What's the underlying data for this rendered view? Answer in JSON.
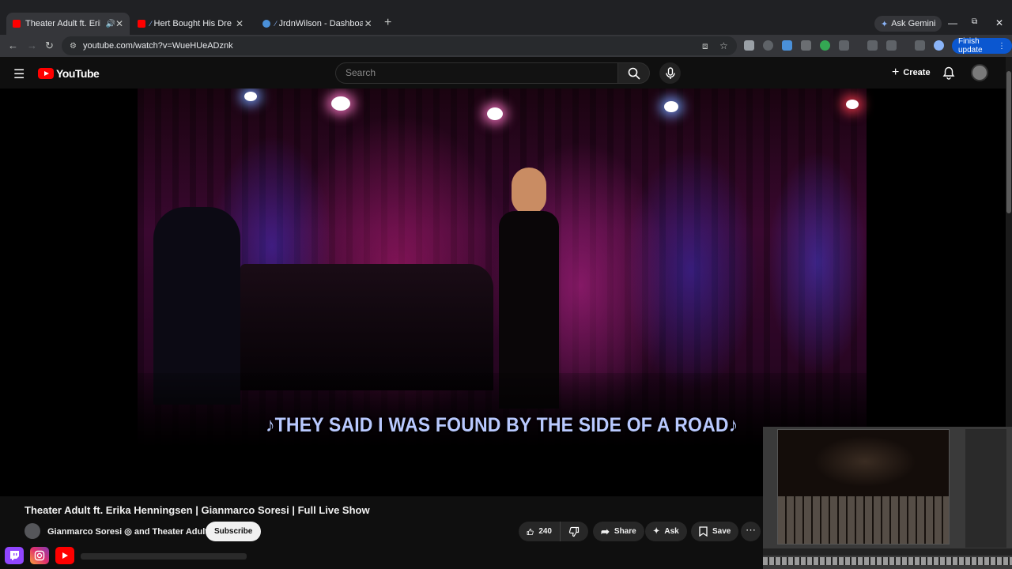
{
  "browser": {
    "tabs": [
      {
        "title": "Theater Adult ft. Erika Henn",
        "active": true,
        "favicon_color": "#ff0000"
      },
      {
        "title": "Hert Bought His Dream Car",
        "active": false,
        "favicon_color": "#ff0000"
      },
      {
        "title": "JrdnWilson - Dashboard",
        "active": false,
        "favicon_color": "#4a90d9"
      }
    ],
    "new_tab_glyph": "+",
    "ask_gemini": "Ask Gemini",
    "url": "youtube.com/watch?v=WueHUeADznk",
    "finish_update": "Finish update"
  },
  "youtube": {
    "logo_text": "YouTube",
    "search_placeholder": "Search",
    "create_label": "Create"
  },
  "video": {
    "caption": "♪THEY SAID I WAS FOUND BY THE SIDE OF A ROAD♪"
  },
  "watch": {
    "title": "Theater Adult ft. Erika Henningsen | Gianmarco Soresi | Full Live Show",
    "channel": "Gianmarco Soresi ◎ and Theater Adult",
    "subscribe": "Subscribe",
    "likes": "240",
    "share": "Share",
    "ask": "Ask",
    "save": "Save"
  },
  "colors": {
    "accent_red": "#ff0000",
    "finish_blue": "#0b57d0",
    "caption_blue": "#b9c9ff"
  }
}
